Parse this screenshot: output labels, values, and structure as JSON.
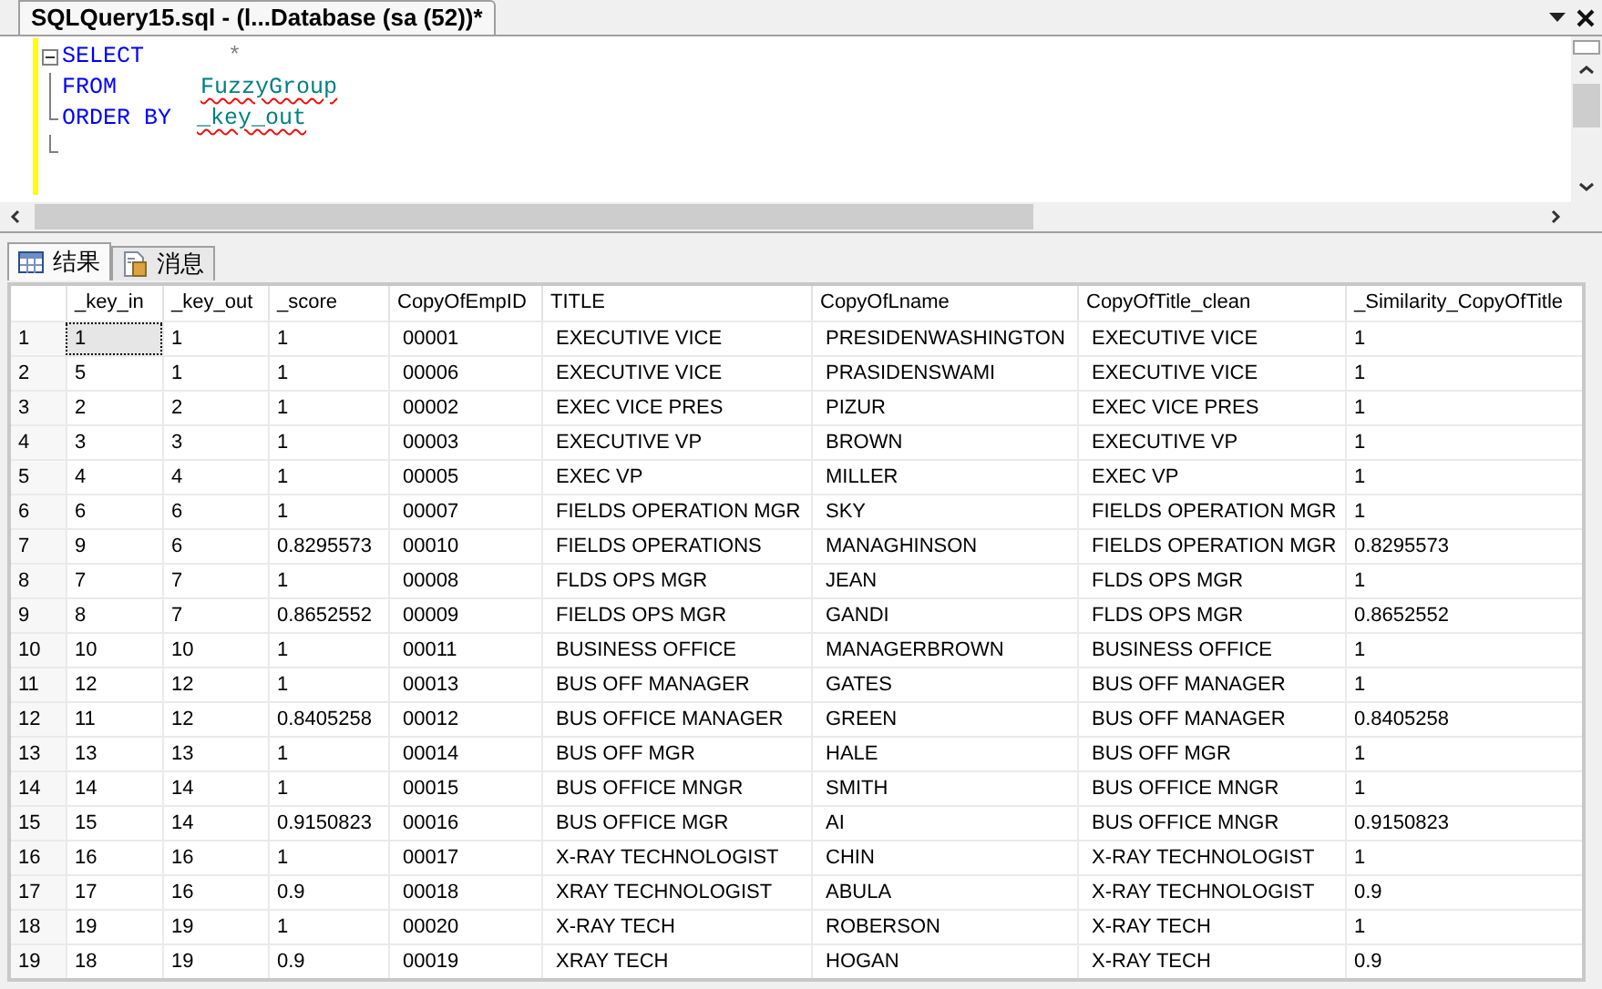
{
  "document_tab": {
    "title": "SQLQuery15.sql - (l...Database (sa (52))*",
    "selected": true
  },
  "editor": {
    "lines": [
      {
        "tokens": [
          {
            "kind": "keyword",
            "text": "SELECT"
          },
          {
            "kind": "operator",
            "text": "*"
          }
        ]
      },
      {
        "tokens": [
          {
            "kind": "keyword",
            "text": "FROM"
          },
          {
            "kind": "identifier",
            "text": "FuzzyGroup"
          }
        ]
      },
      {
        "tokens": [
          {
            "kind": "keyword",
            "text": "ORDER BY"
          },
          {
            "kind": "identifier",
            "text": "_key_out"
          }
        ]
      }
    ]
  },
  "result_tabs": [
    {
      "label": "结果",
      "selected": true
    },
    {
      "label": "消息",
      "selected": false
    }
  ],
  "grid": {
    "columns": [
      "_key_in",
      "_key_out",
      "_score",
      "CopyOfEmpID",
      "TITLE",
      "CopyOfLname",
      "CopyOfTitle_clean",
      "_Similarity_CopyOfTitle"
    ],
    "rows": [
      {
        "number": "1",
        "selected": true,
        "cells": [
          "1",
          "1",
          "1",
          "00001",
          "EXECUTIVE VICE",
          "PRESIDENWASHINGTON",
          "EXECUTIVE VICE",
          "1"
        ]
      },
      {
        "number": "2",
        "selected": false,
        "cells": [
          "5",
          "1",
          "1",
          "00006",
          "EXECUTIVE VICE",
          "PRASIDENSWAMI",
          "EXECUTIVE VICE",
          "1"
        ]
      },
      {
        "number": "3",
        "selected": false,
        "cells": [
          "2",
          "2",
          "1",
          "00002",
          "EXEC VICE PRES",
          "PIZUR",
          "EXEC VICE PRES",
          "1"
        ]
      },
      {
        "number": "4",
        "selected": false,
        "cells": [
          "3",
          "3",
          "1",
          "00003",
          "EXECUTIVE VP",
          "BROWN",
          "EXECUTIVE VP",
          "1"
        ]
      },
      {
        "number": "5",
        "selected": false,
        "cells": [
          "4",
          "4",
          "1",
          "00005",
          "EXEC VP",
          "MILLER",
          "EXEC VP",
          "1"
        ]
      },
      {
        "number": "6",
        "selected": false,
        "cells": [
          "6",
          "6",
          "1",
          "00007",
          "FIELDS OPERATION MGR",
          "SKY",
          "FIELDS OPERATION MGR",
          "1"
        ]
      },
      {
        "number": "7",
        "selected": false,
        "cells": [
          "9",
          "6",
          "0.8295573",
          "00010",
          "FIELDS OPERATIONS",
          "MANAGHINSON",
          "FIELDS OPERATION MGR",
          "0.8295573"
        ]
      },
      {
        "number": "8",
        "selected": false,
        "cells": [
          "7",
          "7",
          "1",
          "00008",
          "FLDS OPS MGR",
          "JEAN",
          "FLDS OPS MGR",
          "1"
        ]
      },
      {
        "number": "9",
        "selected": false,
        "cells": [
          "8",
          "7",
          "0.8652552",
          "00009",
          "FIELDS OPS MGR",
          "GANDI",
          "FLDS OPS MGR",
          "0.8652552"
        ]
      },
      {
        "number": "10",
        "selected": false,
        "cells": [
          "10",
          "10",
          "1",
          "00011",
          "BUSINESS OFFICE",
          "MANAGERBROWN",
          "BUSINESS OFFICE",
          "1"
        ]
      },
      {
        "number": "11",
        "selected": false,
        "cells": [
          "12",
          "12",
          "1",
          "00013",
          "BUS OFF MANAGER",
          "GATES",
          "BUS OFF MANAGER",
          "1"
        ]
      },
      {
        "number": "12",
        "selected": false,
        "cells": [
          "11",
          "12",
          "0.8405258",
          "00012",
          "BUS OFFICE MANAGER",
          "GREEN",
          "BUS OFF MANAGER",
          "0.8405258"
        ]
      },
      {
        "number": "13",
        "selected": false,
        "cells": [
          "13",
          "13",
          "1",
          "00014",
          "BUS OFF MGR",
          "HALE",
          "BUS OFF MGR",
          "1"
        ]
      },
      {
        "number": "14",
        "selected": false,
        "cells": [
          "14",
          "14",
          "1",
          "00015",
          "BUS OFFICE MNGR",
          "SMITH",
          "BUS OFFICE MNGR",
          "1"
        ]
      },
      {
        "number": "15",
        "selected": false,
        "cells": [
          "15",
          "14",
          "0.9150823",
          "00016",
          "BUS OFFICE MGR",
          "AI",
          "BUS OFFICE MNGR",
          "0.9150823"
        ]
      },
      {
        "number": "16",
        "selected": false,
        "cells": [
          "16",
          "16",
          "1",
          "00017",
          "X-RAY TECHNOLOGIST",
          "CHIN",
          "X-RAY TECHNOLOGIST",
          "1"
        ]
      },
      {
        "number": "17",
        "selected": false,
        "cells": [
          "17",
          "16",
          "0.9",
          "00018",
          "XRAY TECHNOLOGIST",
          "ABULA",
          "X-RAY TECHNOLOGIST",
          "0.9"
        ]
      },
      {
        "number": "18",
        "selected": false,
        "cells": [
          "19",
          "19",
          "1",
          "00020",
          "X-RAY TECH",
          "ROBERSON",
          "X-RAY TECH",
          "1"
        ]
      },
      {
        "number": "19",
        "selected": false,
        "cells": [
          "18",
          "19",
          "0.9",
          "00019",
          "XRAY TECH",
          "HOGAN",
          "X-RAY TECH",
          "0.9"
        ]
      }
    ]
  }
}
